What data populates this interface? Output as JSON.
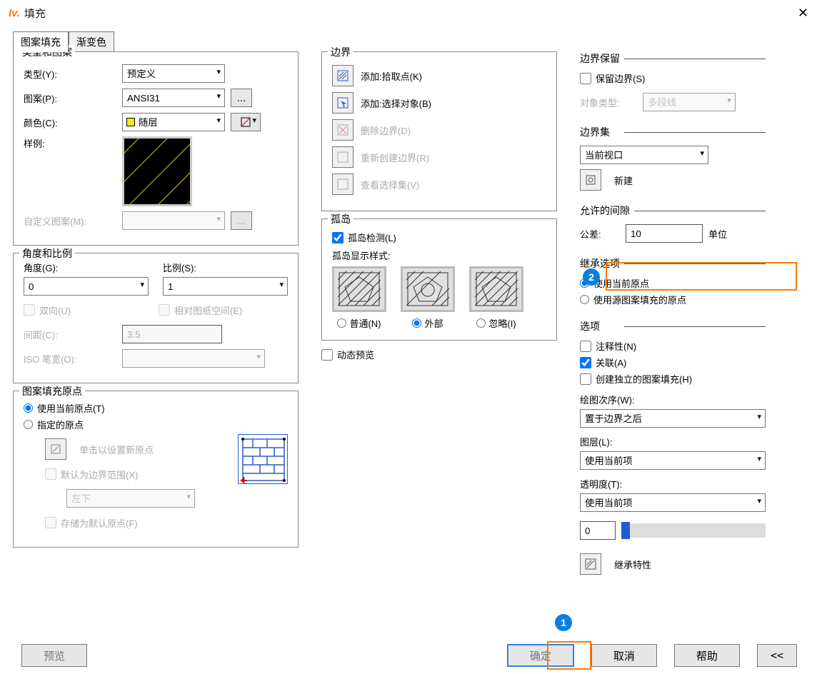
{
  "title": "填充",
  "tabs": {
    "t1": "图案填充",
    "t2": "渐变色"
  },
  "typeGroup": {
    "legend": "类型和图案",
    "typeLabel": "类型(Y):",
    "typeValue": "预定义",
    "patternLabel": "图案(P):",
    "patternValue": "ANSI31",
    "colorLabel": "颜色(C):",
    "colorValue": "随层",
    "sampleLabel": "样例:",
    "customLabel": "自定义图案(M):"
  },
  "angleGroup": {
    "legend": "角度和比例",
    "angleLabel": "角度(G):",
    "angleValue": "0",
    "scaleLabel": "比例(S):",
    "scaleValue": "1",
    "bidir": "双向(U)",
    "relPaper": "相对图纸空间(E)",
    "spacingLabel": "间距(C):",
    "spacingValue": "3.5",
    "isoPenLabel": "ISO 笔宽(O):"
  },
  "originGroup": {
    "legend": "图案填充原点",
    "useCurrent": "使用当前原点(T)",
    "specified": "指定的原点",
    "clickSet": "单击以设置新原点",
    "defaultBound": "默认为边界范围(X)",
    "posValue": "左下",
    "storeDefault": "存储为默认原点(F)"
  },
  "boundary": {
    "legend": "边界",
    "addPick": "添加:拾取点(K)",
    "addSelect": "添加:选择对象(B)",
    "delete": "删除边界(D)",
    "recreate": "重新创建边界(R)",
    "viewSel": "查看选择集(V)"
  },
  "island": {
    "legend": "孤岛",
    "detect": "孤岛检测(L)",
    "styleLabel": "孤岛显示样式:",
    "normal": "普通(N)",
    "outer": "外部",
    "ignore": "忽略(I)"
  },
  "dynPreview": "动态预览",
  "boundRetain": {
    "legend": "边界保留",
    "keep": "保留边界(S)",
    "objTypeLabel": "对象类型:",
    "objTypeValue": "多段线"
  },
  "boundSet": {
    "legend": "边界集",
    "current": "当前视口",
    "newBtn": "新建"
  },
  "gap": {
    "legend": "允许的间隙",
    "tolLabel": "公差:",
    "tolValue": "10",
    "unit": "单位"
  },
  "inherit": {
    "legend": "继承选项",
    "useCurrent": "使用当前原点",
    "useSource": "使用源图案填充的原点"
  },
  "options": {
    "legend": "选项",
    "annot": "注释性(N)",
    "assoc": "关联(A)",
    "indep": "创建独立的图案填充(H)",
    "drawOrderLabel": "绘图次序(W):",
    "drawOrderValue": "置于边界之后",
    "layerLabel": "图层(L):",
    "layerValue": "使用当前项",
    "transpLabel": "透明度(T):",
    "transpValue": "使用当前项",
    "transpNum": "0"
  },
  "inheritProps": "继承特性",
  "buttons": {
    "preview": "预览",
    "ok": "确定",
    "cancel": "取消",
    "help": "帮助",
    "collapse": "<<"
  },
  "callouts": {
    "c1": "1",
    "c2": "2"
  }
}
